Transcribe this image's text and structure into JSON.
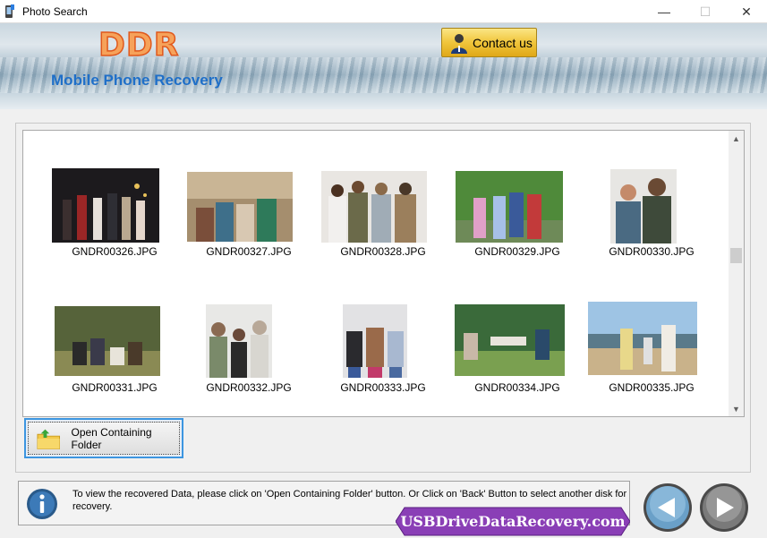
{
  "window": {
    "title": "Photo Search",
    "minimize": "—",
    "maximize": "☐",
    "close": "✕"
  },
  "header": {
    "logo": "DDR",
    "subtitle": "Mobile Phone Recovery",
    "contact_label": "Contact us"
  },
  "gallery": {
    "items": [
      {
        "name": "GNDR00326.JPG"
      },
      {
        "name": "GNDR00327.JPG"
      },
      {
        "name": "GNDR00328.JPG"
      },
      {
        "name": "GNDR00329.JPG"
      },
      {
        "name": "GNDR00330.JPG"
      },
      {
        "name": "GNDR00331.JPG"
      },
      {
        "name": "GNDR00332.JPG"
      },
      {
        "name": "GNDR00333.JPG"
      },
      {
        "name": "GNDR00334.JPG"
      },
      {
        "name": "GNDR00335.JPG"
      }
    ],
    "scroll_up": "▲",
    "scroll_down": "▼"
  },
  "actions": {
    "open_folder_label": "Open Containing Folder"
  },
  "status": {
    "message": "To view the recovered Data, please click on 'Open Containing Folder' button. Or Click on 'Back' Button to select another disk for recovery.",
    "watermark": "USBDriveDataRecovery.com"
  },
  "colors": {
    "accent": "#3c95e0",
    "subtitle": "#1f6fc8",
    "logo": "#f6a25a",
    "watermark_bg": "#8a3fb6"
  }
}
